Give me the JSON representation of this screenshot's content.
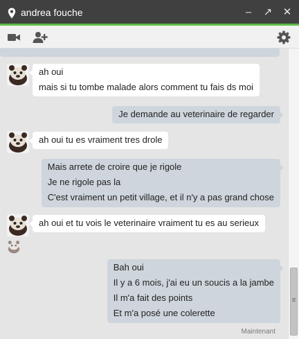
{
  "window": {
    "title": "andrea fouche",
    "presence_icon": "location-pin-icon",
    "controls": {
      "minimize": "–",
      "popout": "↗",
      "close": "✕"
    },
    "accent_color": "#5fbb46",
    "titlebar_color": "#404040"
  },
  "toolbar": {
    "video_icon": "video-camera-icon",
    "add_person_icon": "add-person-icon",
    "settings_icon": "gear-icon"
  },
  "colors": {
    "incoming_bubble": "#ffffff",
    "outgoing_bubble": "#ced5dc",
    "chat_background": "#e5e5e5"
  },
  "messages": [
    {
      "from": "contact",
      "lines": [
        "ah oui",
        "mais si tu tombe malade alors comment tu fais ds moi"
      ]
    },
    {
      "from": "me",
      "lines": [
        "Je demande au veterinaire de regarder"
      ]
    },
    {
      "from": "contact",
      "lines": [
        "ah oui tu es vraiment tres drole"
      ]
    },
    {
      "from": "me",
      "lines": [
        "Mais arrete de croire que je rigole",
        "Je ne rigole pas la",
        "C'est vraiment un petit village, et il n'y a pas grand chose"
      ]
    },
    {
      "from": "contact",
      "lines": [
        "ah oui et tu vois le veterinaire vraiment tu es au serieux"
      ]
    },
    {
      "from": "me",
      "lines": [
        "Bah oui",
        "Il y a 6 mois, j'ai eu un soucis a la jambe",
        "Il m'a fait des points",
        "Et m'a posé une colerette"
      ]
    }
  ],
  "status": {
    "timestamp": "Maintenant"
  }
}
